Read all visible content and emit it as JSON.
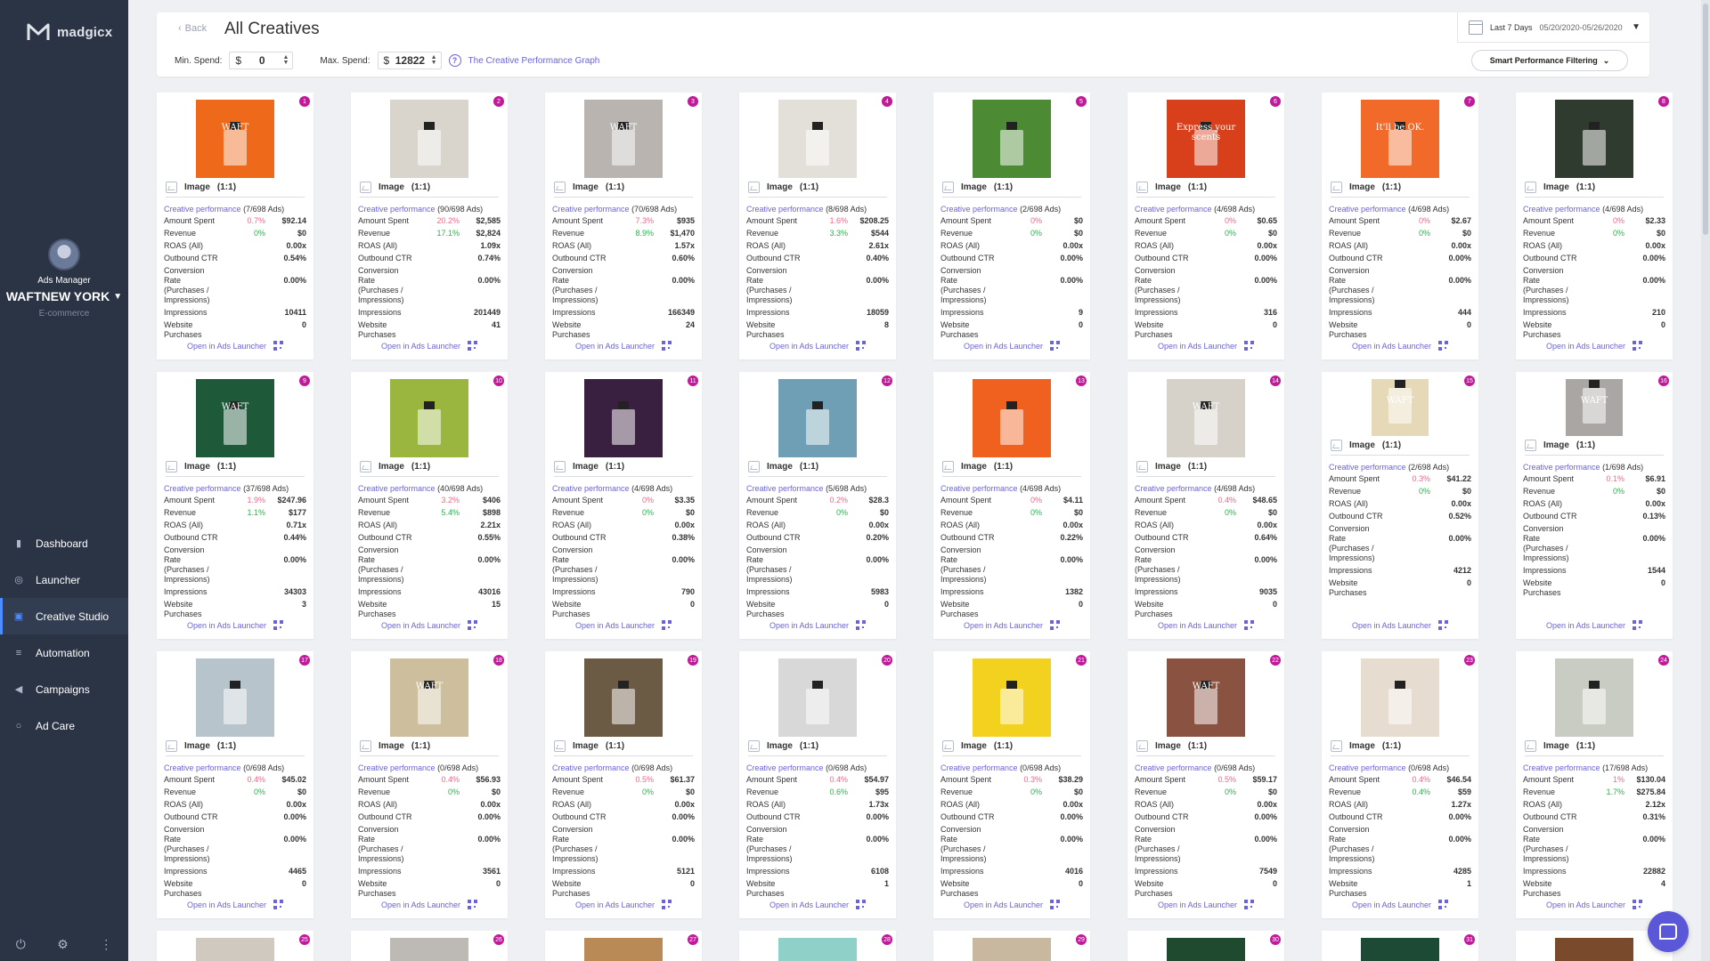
{
  "app": {
    "logo": "madgicx",
    "role": "Ads Manager",
    "account": "WAFTNEW YORK",
    "vertical": "E-commerce",
    "accent": "#6b64d8",
    "badge_color": "#c2189a"
  },
  "nav": [
    {
      "label": "Dashboard",
      "icon": "bar-chart-icon"
    },
    {
      "label": "Launcher",
      "icon": "target-icon"
    },
    {
      "label": "Creative Studio",
      "icon": "image-icon"
    },
    {
      "label": "Automation",
      "icon": "sliders-icon"
    },
    {
      "label": "Campaigns",
      "icon": "megaphone-icon"
    },
    {
      "label": "Ad Care",
      "icon": "circle-icon"
    }
  ],
  "header": {
    "back": "Back",
    "title": "All Creatives",
    "date_preset": "Last 7 Days",
    "date_range": "05/20/2020-05/26/2020",
    "min_label": "Min. Spend:",
    "min_cur": "$",
    "min_value": "0",
    "max_label": "Max. Spend:",
    "max_cur": "$",
    "max_value": "12822",
    "graph_link": "The Creative Performance Graph",
    "filter": "Smart Performance Filtering"
  },
  "labels": {
    "type": "Image",
    "ratio": "(1:1)",
    "cp": "Creative performance",
    "amount": "Amount Spent",
    "revenue": "Revenue",
    "roas": "ROAS (All)",
    "ctr": "Outbound CTR",
    "conv": "Conversion Rate (Purchases / Impressions)",
    "impr": "Impressions",
    "purch": "Website Purchases",
    "launch": "Open in Ads Launcher"
  },
  "cards": [
    {
      "n": "1",
      "ads": "(7/698 Ads)",
      "spend_pct": "0.7%",
      "spend": "$92.14",
      "rev_pct": "0%",
      "rev": "$0",
      "roas": "0.00x",
      "ctr": "0.54%",
      "conv": "0.00%",
      "impr": "10411",
      "purch": "0",
      "bg": "#ee6a1a",
      "thumb": "WAFT"
    },
    {
      "n": "2",
      "ads": "(90/698 Ads)",
      "spend_pct": "20.2%",
      "spend": "$2,585",
      "rev_pct": "17.1%",
      "rev": "$2,824",
      "roas": "1.09x",
      "ctr": "0.74%",
      "conv": "0.00%",
      "impr": "201449",
      "purch": "41",
      "bg": "#d9d4cc",
      "thumb": ""
    },
    {
      "n": "3",
      "ads": "(70/698 Ads)",
      "spend_pct": "7.3%",
      "spend": "$935",
      "rev_pct": "8.9%",
      "rev": "$1,470",
      "roas": "1.57x",
      "ctr": "0.60%",
      "conv": "0.00%",
      "impr": "166349",
      "purch": "24",
      "bg": "#b9b4b0",
      "thumb": "WAFT"
    },
    {
      "n": "4",
      "ads": "(8/698 Ads)",
      "spend_pct": "1.6%",
      "spend": "$208.25",
      "rev_pct": "3.3%",
      "rev": "$544",
      "roas": "2.61x",
      "ctr": "0.40%",
      "conv": "0.00%",
      "impr": "18059",
      "purch": "8",
      "bg": "#e3e0da",
      "thumb": ""
    },
    {
      "n": "5",
      "ads": "(2/698 Ads)",
      "spend_pct": "0%",
      "spend": "$0",
      "rev_pct": "0%",
      "rev": "$0",
      "roas": "0.00x",
      "ctr": "0.00%",
      "conv": "0.00%",
      "impr": "9",
      "purch": "0",
      "bg": "#4c8a34",
      "thumb": ""
    },
    {
      "n": "6",
      "ads": "(4/698 Ads)",
      "spend_pct": "0%",
      "spend": "$0.65",
      "rev_pct": "0%",
      "rev": "$0",
      "roas": "0.00x",
      "ctr": "0.00%",
      "conv": "0.00%",
      "impr": "316",
      "purch": "0",
      "bg": "#d8401c",
      "thumb": "Express your scents"
    },
    {
      "n": "7",
      "ads": "(4/698 Ads)",
      "spend_pct": "0%",
      "spend": "$2.67",
      "rev_pct": "0%",
      "rev": "$0",
      "roas": "0.00x",
      "ctr": "0.00%",
      "conv": "0.00%",
      "impr": "444",
      "purch": "0",
      "bg": "#f26a2a",
      "thumb": "It'll be OK."
    },
    {
      "n": "8",
      "ads": "(4/698 Ads)",
      "spend_pct": "0%",
      "spend": "$2.33",
      "rev_pct": "0%",
      "rev": "$0",
      "roas": "0.00x",
      "ctr": "0.00%",
      "conv": "0.00%",
      "impr": "210",
      "purch": "0",
      "bg": "#2f3b2e",
      "thumb": ""
    },
    {
      "n": "9",
      "ads": "(37/698 Ads)",
      "spend_pct": "1.9%",
      "spend": "$247.96",
      "rev_pct": "1.1%",
      "rev": "$177",
      "roas": "0.71x",
      "ctr": "0.44%",
      "conv": "0.00%",
      "impr": "34303",
      "purch": "3",
      "bg": "#1e5a3a",
      "thumb": "WAFT"
    },
    {
      "n": "10",
      "ads": "(40/698 Ads)",
      "spend_pct": "3.2%",
      "spend": "$406",
      "rev_pct": "5.4%",
      "rev": "$898",
      "roas": "2.21x",
      "ctr": "0.55%",
      "conv": "0.00%",
      "impr": "43016",
      "purch": "15",
      "bg": "#9bb63e",
      "thumb": ""
    },
    {
      "n": "11",
      "ads": "(4/698 Ads)",
      "spend_pct": "0%",
      "spend": "$3.35",
      "rev_pct": "0%",
      "rev": "$0",
      "roas": "0.00x",
      "ctr": "0.38%",
      "conv": "0.00%",
      "impr": "790",
      "purch": "0",
      "bg": "#3a2040",
      "thumb": ""
    },
    {
      "n": "12",
      "ads": "(5/698 Ads)",
      "spend_pct": "0.2%",
      "spend": "$28.3",
      "rev_pct": "0%",
      "rev": "$0",
      "roas": "0.00x",
      "ctr": "0.20%",
      "conv": "0.00%",
      "impr": "5983",
      "purch": "0",
      "bg": "#6f9fb4",
      "thumb": ""
    },
    {
      "n": "13",
      "ads": "(4/698 Ads)",
      "spend_pct": "0%",
      "spend": "$4.11",
      "rev_pct": "0%",
      "rev": "$0",
      "roas": "0.00x",
      "ctr": "0.22%",
      "conv": "0.00%",
      "impr": "1382",
      "purch": "0",
      "bg": "#f0601e",
      "thumb": ""
    },
    {
      "n": "14",
      "ads": "(4/698 Ads)",
      "spend_pct": "0.4%",
      "spend": "$48.65",
      "rev_pct": "0%",
      "rev": "$0",
      "roas": "0.00x",
      "ctr": "0.64%",
      "conv": "0.00%",
      "impr": "9035",
      "purch": "0",
      "bg": "#d6d2ca",
      "thumb": "WAFT"
    },
    {
      "n": "15",
      "ads": "(2/698 Ads)",
      "spend_pct": "0.3%",
      "spend": "$41.22",
      "rev_pct": "0%",
      "rev": "$0",
      "roas": "0.00x",
      "ctr": "0.52%",
      "conv": "0.00%",
      "impr": "4212",
      "purch": "0",
      "bg": "#e6d9b8",
      "thumb": "WAFT",
      "small": true
    },
    {
      "n": "16",
      "ads": "(1/698 Ads)",
      "spend_pct": "0.1%",
      "spend": "$6.91",
      "rev_pct": "0%",
      "rev": "$0",
      "roas": "0.00x",
      "ctr": "0.13%",
      "conv": "0.00%",
      "impr": "1544",
      "purch": "0",
      "bg": "#a9a6a4",
      "thumb": "WAFT",
      "small": true
    },
    {
      "n": "17",
      "ads": "(0/698 Ads)",
      "spend_pct": "0.4%",
      "spend": "$45.02",
      "rev_pct": "0%",
      "rev": "$0",
      "roas": "0.00x",
      "ctr": "0.00%",
      "conv": "0.00%",
      "impr": "4465",
      "purch": "0",
      "bg": "#b8c4cc",
      "thumb": ""
    },
    {
      "n": "18",
      "ads": "(0/698 Ads)",
      "spend_pct": "0.4%",
      "spend": "$56.93",
      "rev_pct": "0%",
      "rev": "$0",
      "roas": "0.00x",
      "ctr": "0.00%",
      "conv": "0.00%",
      "impr": "3561",
      "purch": "0",
      "bg": "#cdbf9e",
      "thumb": "WAFT"
    },
    {
      "n": "19",
      "ads": "(0/698 Ads)",
      "spend_pct": "0.5%",
      "spend": "$61.37",
      "rev_pct": "0%",
      "rev": "$0",
      "roas": "0.00x",
      "ctr": "0.00%",
      "conv": "0.00%",
      "impr": "5121",
      "purch": "0",
      "bg": "#6b5a44",
      "thumb": ""
    },
    {
      "n": "20",
      "ads": "(0/698 Ads)",
      "spend_pct": "0.4%",
      "spend": "$54.97",
      "rev_pct": "0.6%",
      "rev": "$95",
      "roas": "1.73x",
      "ctr": "0.00%",
      "conv": "0.00%",
      "impr": "6108",
      "purch": "1",
      "bg": "#d8d8d8",
      "thumb": ""
    },
    {
      "n": "21",
      "ads": "(0/698 Ads)",
      "spend_pct": "0.3%",
      "spend": "$38.29",
      "rev_pct": "0%",
      "rev": "$0",
      "roas": "0.00x",
      "ctr": "0.00%",
      "conv": "0.00%",
      "impr": "4016",
      "purch": "0",
      "bg": "#f2d21e",
      "thumb": ""
    },
    {
      "n": "22",
      "ads": "(0/698 Ads)",
      "spend_pct": "0.5%",
      "spend": "$59.17",
      "rev_pct": "0%",
      "rev": "$0",
      "roas": "0.00x",
      "ctr": "0.00%",
      "conv": "0.00%",
      "impr": "7549",
      "purch": "0",
      "bg": "#8a5240",
      "thumb": "WAFT"
    },
    {
      "n": "23",
      "ads": "(0/698 Ads)",
      "spend_pct": "0.4%",
      "spend": "$46.54",
      "rev_pct": "0.4%",
      "rev": "$59",
      "roas": "1.27x",
      "ctr": "0.00%",
      "conv": "0.00%",
      "impr": "4285",
      "purch": "1",
      "bg": "#e6dccf",
      "thumb": ""
    },
    {
      "n": "24",
      "ads": "(17/698 Ads)",
      "spend_pct": "1%",
      "spend": "$130.04",
      "rev_pct": "1.7%",
      "rev": "$275.84",
      "roas": "2.12x",
      "ctr": "0.31%",
      "conv": "0.00%",
      "impr": "22882",
      "purch": "4",
      "bg": "#c9ccc2",
      "thumb": ""
    }
  ],
  "peek": [
    {
      "n": "25",
      "bg": "#cfc9c0"
    },
    {
      "n": "26",
      "bg": "#bdbab6"
    },
    {
      "n": "27",
      "bg": "#b98a55"
    },
    {
      "n": "28",
      "bg": "#8fd0c8"
    },
    {
      "n": "29",
      "bg": "#c9b8a0"
    },
    {
      "n": "30",
      "bg": "#1f4a30"
    },
    {
      "n": "31",
      "bg": "#1c4a35"
    },
    {
      "n": "32",
      "bg": "#7a4a2c"
    }
  ]
}
